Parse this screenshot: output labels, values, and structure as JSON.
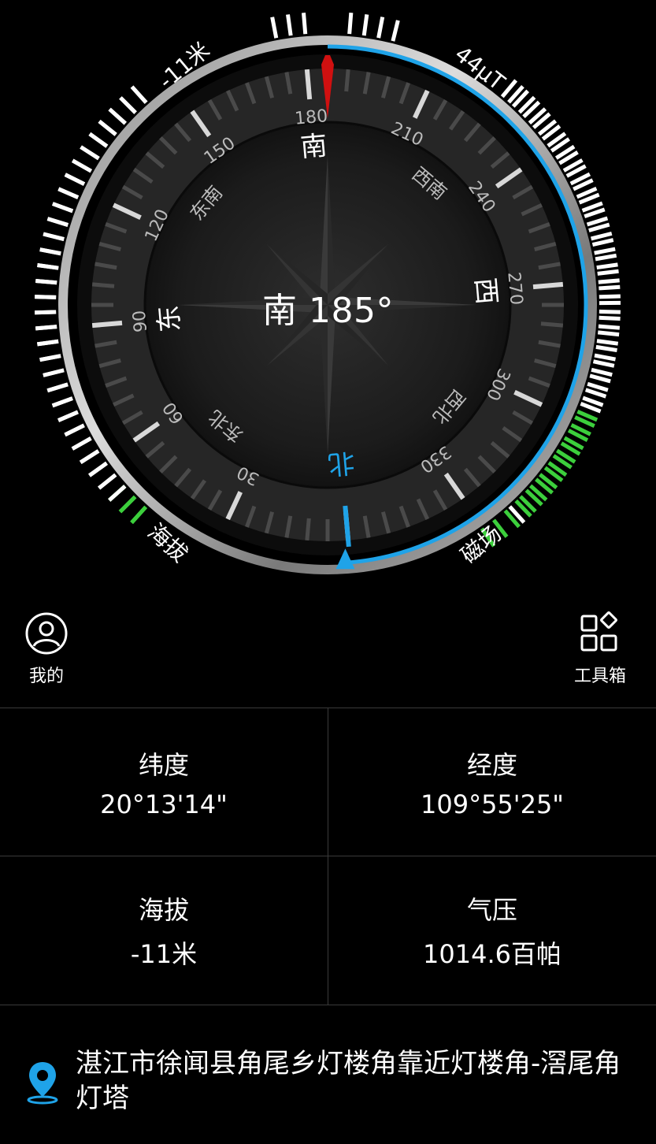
{
  "compass": {
    "heading_text": "南 185°",
    "cardinals": {
      "north": "北",
      "east": "东",
      "south": "南",
      "west": "西"
    },
    "intercardinals": {
      "northeast": "东北",
      "southeast": "东南",
      "southwest": "西南",
      "northwest": "西北"
    },
    "degree_labels": [
      "30",
      "60",
      "90",
      "120",
      "150",
      "180",
      "210",
      "240",
      "270",
      "300",
      "330"
    ],
    "altitude_gauge_label": "海拔",
    "altitude_gauge_value": "-11米",
    "magnetic_gauge_label": "磁场",
    "magnetic_gauge_value": "44μT",
    "accent_blue": "#1fa3e8",
    "needle_red": "#d01010",
    "gauge_green": "#3ccf3c"
  },
  "actions": {
    "mine_label": "我的",
    "tools_label": "工具箱"
  },
  "info": {
    "latitude_label": "纬度",
    "latitude_value": "20°13'14\"",
    "longitude_label": "经度",
    "longitude_value": "109°55'25\"",
    "altitude_label": "海拔",
    "altitude_value": "-11米",
    "pressure_label": "气压",
    "pressure_value": "1014.6百帕"
  },
  "location": {
    "address": "湛江市徐闻县角尾乡灯楼角靠近灯楼角-滘尾角灯塔"
  }
}
